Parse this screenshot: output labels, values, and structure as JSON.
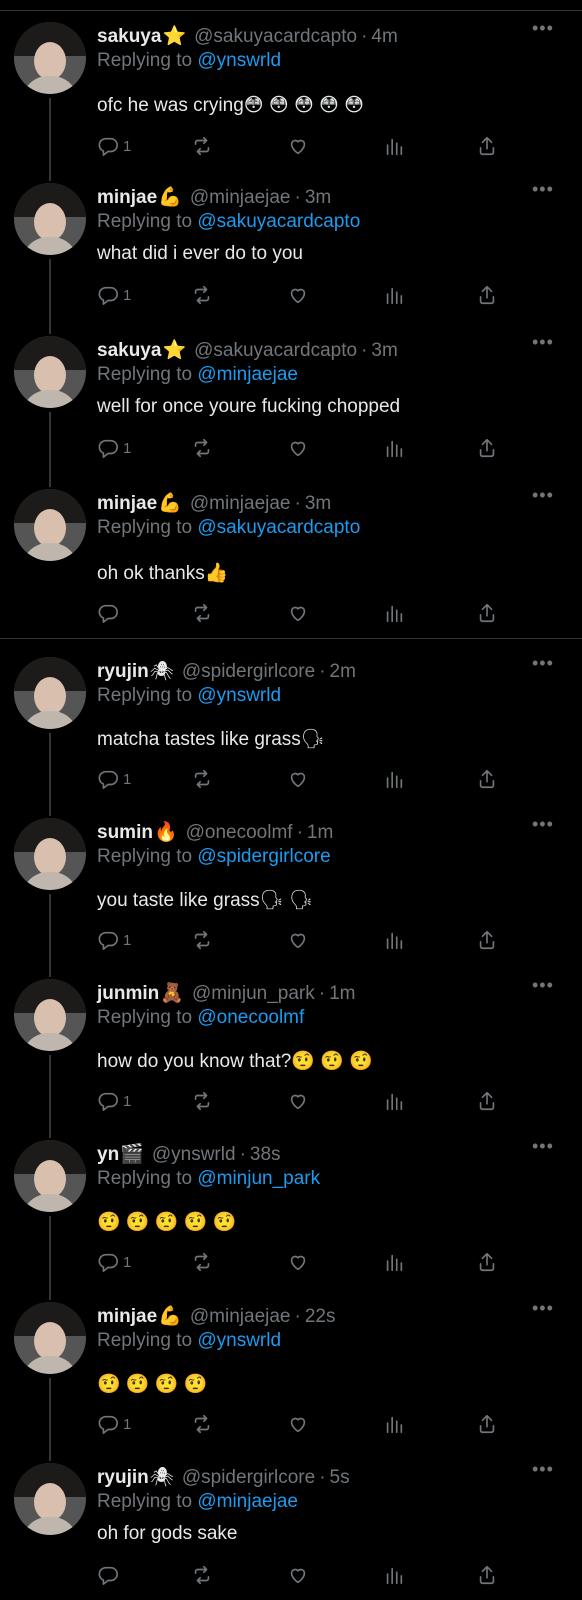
{
  "colors": {
    "background": "#000000",
    "text": "#e7e9ea",
    "muted": "#71767b",
    "link": "#1d9bf0",
    "divider": "#2f3336"
  },
  "icons": {
    "reply": "reply-icon",
    "retweet": "retweet-icon",
    "like": "heart-icon",
    "views": "views-icon",
    "share": "share-icon",
    "more": "more-icon"
  },
  "more_label": "•••",
  "reply_prefix": "Replying to ",
  "tweets": [
    {
      "name": "sakuya",
      "badge": "⭐",
      "handle": "@sakuyacardcapto",
      "time": "4m",
      "reply_to": "@ynswrld",
      "text": "ofc he was crying😳 😳 😳 😳 😳",
      "reply_count": "1"
    },
    {
      "name": "minjae",
      "badge": "💪",
      "handle": "@minjaejae",
      "time": "3m",
      "reply_to": "@sakuyacardcapto",
      "text": "what did i ever do to you",
      "reply_count": "1"
    },
    {
      "name": "sakuya",
      "badge": "⭐",
      "handle": "@sakuyacardcapto",
      "time": "3m",
      "reply_to": "@minjaejae",
      "text": "well for once youre fucking chopped",
      "reply_count": "1"
    },
    {
      "name": "minjae",
      "badge": "💪",
      "handle": "@minjaejae",
      "time": "3m",
      "reply_to": "@sakuyacardcapto",
      "text": "oh ok thanks👍",
      "reply_count": ""
    },
    {
      "name": "ryujin",
      "badge": "🕷",
      "handle": "@spidergirlcore",
      "time": "2m",
      "reply_to": "@ynswrld",
      "text": "matcha tastes like grass🗣",
      "reply_count": "1"
    },
    {
      "name": "sumin",
      "badge": "🔥",
      "handle": "@onecoolmf",
      "time": "1m",
      "reply_to": "@spidergirlcore",
      "text": "you taste like grass🗣 🗣",
      "reply_count": "1"
    },
    {
      "name": "junmin",
      "badge": "🧸",
      "handle": "@minjun_park",
      "time": "1m",
      "reply_to": "@onecoolmf",
      "text": "how do you know that?🤨 🤨 🤨",
      "reply_count": "1"
    },
    {
      "name": "yn",
      "badge": "🎬",
      "handle": "@ynswrld",
      "time": "38s",
      "reply_to": "@minjun_park",
      "text": "🤨 🤨 🤨 🤨 🤨",
      "reply_count": "1"
    },
    {
      "name": "minjae",
      "badge": "💪",
      "handle": "@minjaejae",
      "time": "22s",
      "reply_to": "@ynswrld",
      "text": "🤨 🤨 🤨 🤨",
      "reply_count": "1"
    },
    {
      "name": "ryujin",
      "badge": "🕷",
      "handle": "@spidergirlcore",
      "time": "5s",
      "reply_to": "@minjaejae",
      "text": "oh for gods sake",
      "reply_count": ""
    }
  ]
}
